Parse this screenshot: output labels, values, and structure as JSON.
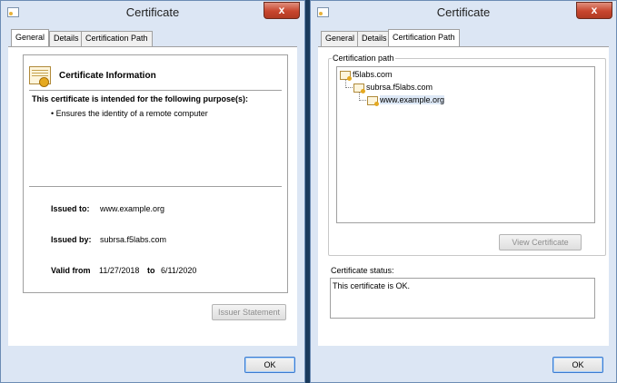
{
  "left_window": {
    "title": "Certificate",
    "close_label": "x",
    "tabs": [
      {
        "label": "General",
        "active": true
      },
      {
        "label": "Details",
        "active": false
      },
      {
        "label": "Certification Path",
        "active": false
      }
    ],
    "info_heading": "Certificate Information",
    "purpose_title": "This certificate is intended for the following purpose(s):",
    "purpose_items": [
      "• Ensures the identity of a remote computer"
    ],
    "issued_to_label": "Issued to:",
    "issued_to_value": "www.example.org",
    "issued_by_label": "Issued by:",
    "issued_by_value": "subrsa.f5labs.com",
    "valid_from_label": "Valid from",
    "valid_from_value": "11/27/2018",
    "valid_to_label": "to",
    "valid_to_value": "6/11/2020",
    "issuer_statement_label": "Issuer Statement",
    "ok_label": "OK"
  },
  "right_window": {
    "title": "Certificate",
    "close_label": "x",
    "tabs": [
      {
        "label": "General",
        "active": false
      },
      {
        "label": "Details",
        "active": false
      },
      {
        "label": "Certification Path",
        "active": true
      }
    ],
    "cert_path_label": "Certification path",
    "tree": [
      {
        "label": "f5labs.com",
        "level": 0
      },
      {
        "label": "subrsa.f5labs.com",
        "level": 1
      },
      {
        "label": "www.example.org",
        "level": 2
      }
    ],
    "view_certificate_label": "View Certificate",
    "status_label": "Certificate status:",
    "status_text": "This certificate is OK.",
    "ok_label": "OK"
  },
  "colors": {
    "window_bg": "#dce6f4",
    "close_red": "#c7462e",
    "ok_border": "#3b7bd0"
  }
}
